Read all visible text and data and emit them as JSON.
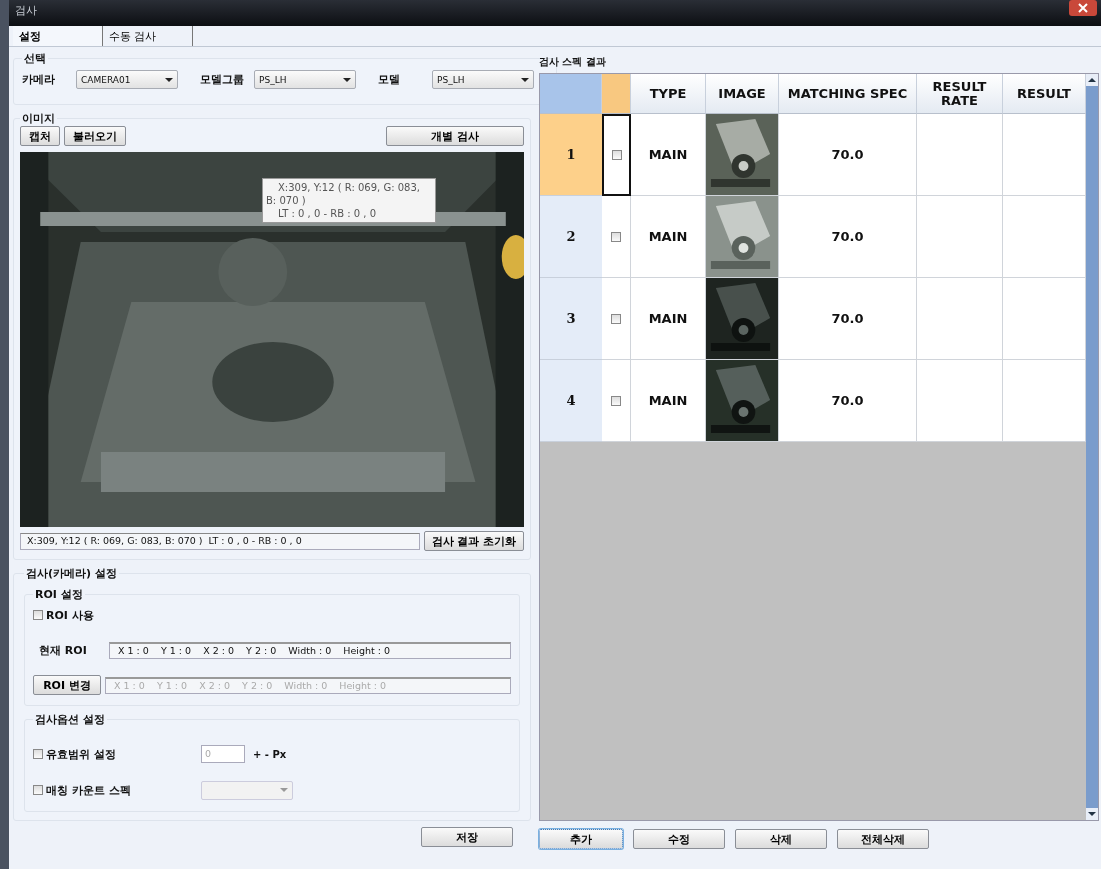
{
  "window": {
    "title": "검사"
  },
  "tabs": [
    {
      "label": "설정",
      "selected": true
    },
    {
      "label": "수동 검사",
      "selected": false
    }
  ],
  "selection": {
    "title": "선택",
    "fields": [
      {
        "label": "카메라",
        "value": "CAMERA01"
      },
      {
        "label": "모델그룹",
        "value": "PS_LH"
      },
      {
        "label": "모델",
        "value": "PS_LH"
      }
    ]
  },
  "image": {
    "title": "이미지",
    "buttons": [
      "캡처",
      "불러오기"
    ],
    "inspect_button": "개별 검사",
    "tooltip": {
      "coords": "X:309, Y:12 ( R: 069, G: 083, B: 070 )",
      "rect": "LT : 0 , 0 - RB : 0 , 0"
    },
    "status": "X:309, Y:12 ( R: 069, G: 083, B: 070 )  LT : 0 , 0 - RB : 0 , 0",
    "reset_button": "검사 결과 초기화"
  },
  "settings": {
    "title": "검사(카메라) 설정",
    "roi": {
      "title": "ROI 설정",
      "use": {
        "label": "ROI 사용",
        "checked": false
      },
      "current_label": "현재 ROI",
      "current_value": "X 1 : 0    Y 1 : 0    X 2 : 0    Y 2 : 0    Width : 0    Height : 0",
      "change_button": "ROI 변경",
      "change_value": "X 1 : 0    Y 1 : 0    X 2 : 0    Y 2 : 0    Width : 0    Height : 0",
      "change_disabled": true
    },
    "options": {
      "title": "검사옵션 설정",
      "range": {
        "label": "유효범위 설정",
        "checked": false,
        "value": "0",
        "disabled": true,
        "unit": "+ - Px"
      },
      "count": {
        "label": "매칭 카운트 스펙",
        "checked": false
      }
    },
    "save_button": "저장"
  },
  "results": {
    "title": "검사 스펙 결과",
    "columns": [
      "TYPE",
      "IMAGE",
      "MATCHING SPEC",
      "RESULT RATE",
      "RESULT"
    ],
    "rows": [
      {
        "number": "1",
        "checked": false,
        "selected": true,
        "type": "MAIN",
        "spec": "70.0"
      },
      {
        "number": "2",
        "checked": false,
        "selected": false,
        "type": "MAIN",
        "spec": "70.0"
      },
      {
        "number": "3",
        "checked": false,
        "selected": false,
        "type": "MAIN",
        "spec": "70.0"
      },
      {
        "number": "4",
        "checked": false,
        "selected": false,
        "type": "MAIN",
        "spec": "70.0"
      }
    ],
    "buttons": [
      "추가",
      "수정",
      "삭제",
      "전체삭제"
    ]
  }
}
